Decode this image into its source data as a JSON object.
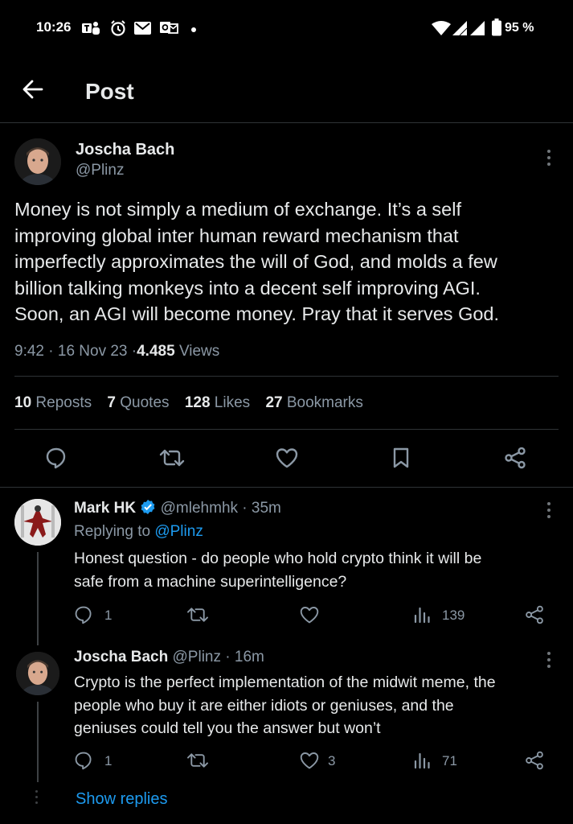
{
  "status_bar": {
    "time": "10:26",
    "battery": "95 %"
  },
  "header": {
    "title": "Post"
  },
  "post": {
    "author_name": "Joscha Bach",
    "author_handle": "@Plinz",
    "text_lines": [
      "Money is not simply a medium of exchange. It’s a self",
      "improving global inter human reward mechanism that",
      "imperfectly approximates the will of God, and molds a few",
      "billion talking monkeys into a decent self improving AGI.",
      "Soon, an AGI will become money. Pray that it serves God."
    ],
    "time": "9:42",
    "date": "16 Nov 23",
    "views_count": "4.485",
    "views_label": "Views",
    "sep": "·",
    "stats": {
      "reposts_count": "10",
      "reposts_label": "Reposts",
      "quotes_count": "7",
      "quotes_label": "Quotes",
      "likes_count": "128",
      "likes_label": "Likes",
      "bookmarks_count": "27",
      "bookmarks_label": "Bookmarks"
    }
  },
  "replies": [
    {
      "author_name": "Mark HK",
      "author_handle": "@mlehmhk",
      "time_ago": "· 35m",
      "replying_prefix": "Replying to",
      "replying_handle": "@Plinz",
      "text_lines": [
        "Honest question - do people who hold crypto think it will be",
        "safe from a machine superintelligence?"
      ],
      "reply_count": "1",
      "like_count": "",
      "view_count": "139"
    },
    {
      "author_name": "Joscha Bach",
      "author_handle": "@Plinz",
      "time_ago": "· 16m",
      "text_lines": [
        "Crypto is the perfect implementation of the midwit meme, the",
        "people who buy it are either idiots or geniuses, and the",
        "geniuses could tell you the answer but won’t"
      ],
      "reply_count": "1",
      "like_count": "3",
      "view_count": "71"
    }
  ],
  "show_replies": "Show replies",
  "colors": {
    "background": "#000000",
    "text": "#e7e9ea",
    "secondary": "#8b98a5",
    "accent": "#1d9bf0",
    "divider": "#2f3336"
  }
}
